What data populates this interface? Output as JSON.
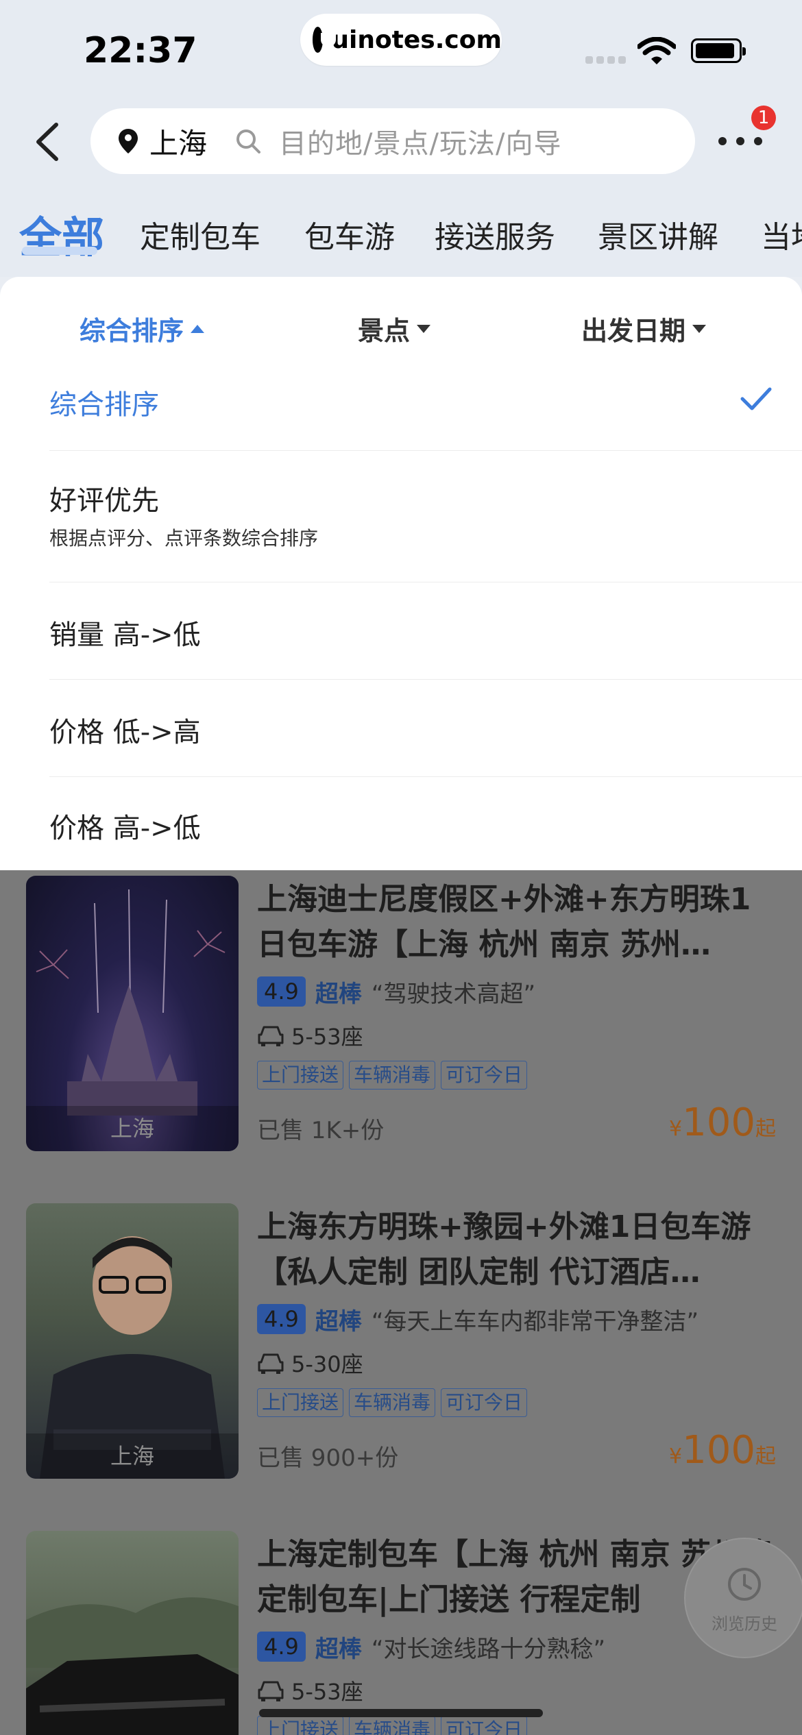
{
  "status_bar": {
    "time": "22:37",
    "url": "uinotes.com"
  },
  "header": {
    "city": "上海",
    "search_placeholder": "目的地/景点/玩法/向导",
    "more_badge": "1"
  },
  "category_tabs": [
    {
      "label": "全部",
      "active": true
    },
    {
      "label": "定制包车"
    },
    {
      "label": "包车游"
    },
    {
      "label": "接送服务"
    },
    {
      "label": "景区讲解"
    },
    {
      "label": "当地"
    }
  ],
  "filter_tabs": [
    {
      "label": "综合排序",
      "active": true
    },
    {
      "label": "景点"
    },
    {
      "label": "出发日期"
    }
  ],
  "sort_options": [
    {
      "label": "综合排序",
      "selected": true
    },
    {
      "label": "好评优先",
      "sub": "根据点评分、点评条数综合排序"
    },
    {
      "label": "销量 高->低"
    },
    {
      "label": "价格 低->高"
    },
    {
      "label": "价格 高->低"
    }
  ],
  "products": [
    {
      "title": "上海迪士尼度假区+外滩+东方明珠1日包车游【上海 杭州 南京 苏州…",
      "image_caption": "上海",
      "score": "4.9",
      "rating_text": "超棒",
      "review": "“驾驶技术高超”",
      "seats": "5-53座",
      "tags": [
        "上门接送",
        "车辆消毒",
        "可订今日"
      ],
      "sold": "已售 1K+份",
      "currency": "¥",
      "price": "100",
      "price_suffix": "起"
    },
    {
      "title": "上海东方明珠+豫园+外滩1日包车游【私人定制  团队定制  代订酒店…",
      "image_caption": "上海",
      "score": "4.9",
      "rating_text": "超棒",
      "review": "“每天上车车内都非常干净整洁”",
      "seats": "5-30座",
      "tags": [
        "上门接送",
        "车辆消毒",
        "可订今日"
      ],
      "sold": "已售 900+份",
      "currency": "¥",
      "price": "100",
      "price_suffix": "起"
    },
    {
      "title": "上海定制包车【上海 杭州 南京 苏州等定制包车|上门接送 行程定制",
      "image_caption": "",
      "score": "4.9",
      "rating_text": "超棒",
      "review": "“对长途线路十分熟稔”",
      "seats": "5-53座",
      "tags": [
        "上门接送",
        "车辆消毒",
        "可订今日"
      ]
    }
  ],
  "history_button": {
    "label": "浏览历史"
  },
  "colors": {
    "accent": "#3d7ddc",
    "badge": "#e8332f",
    "price": "#ff6a00"
  }
}
